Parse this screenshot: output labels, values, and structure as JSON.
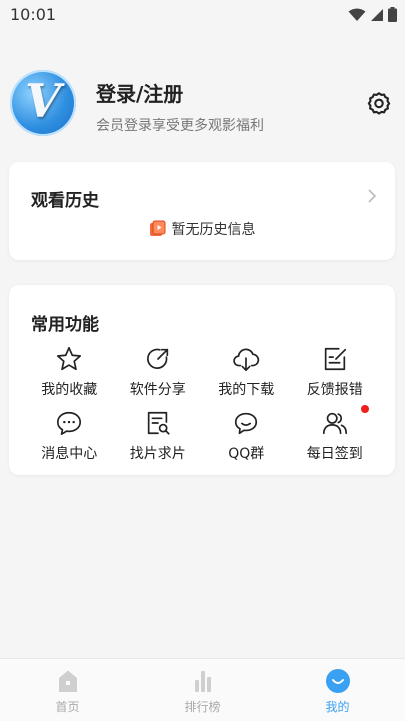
{
  "status_bar": {
    "time": "10:01"
  },
  "profile": {
    "title": "登录/注册",
    "subtitle": "会员登录享受更多观影福利",
    "avatar_letter": "V"
  },
  "history": {
    "title": "观看历史",
    "empty_text": "暂无历史信息"
  },
  "functions": {
    "title": "常用功能",
    "items": [
      {
        "label": "我的收藏",
        "icon": "star-icon"
      },
      {
        "label": "软件分享",
        "icon": "share-icon"
      },
      {
        "label": "我的下载",
        "icon": "cloud-download-icon"
      },
      {
        "label": "反馈报错",
        "icon": "feedback-edit-icon"
      },
      {
        "label": "消息中心",
        "icon": "chat-bubble-icon"
      },
      {
        "label": "找片求片",
        "icon": "document-search-icon"
      },
      {
        "label": "QQ群",
        "icon": "group-chat-icon"
      },
      {
        "label": "每日签到",
        "icon": "users-icon"
      }
    ]
  },
  "bottom_nav": {
    "items": [
      {
        "label": "首页",
        "icon": "home-icon"
      },
      {
        "label": "排行榜",
        "icon": "bar-chart-icon"
      },
      {
        "label": "我的",
        "icon": "smile-icon"
      }
    ],
    "active": "我的"
  },
  "colors": {
    "accent": "#3aa0f2",
    "badge": "#f11c1c",
    "background": "#f5f5f5"
  }
}
